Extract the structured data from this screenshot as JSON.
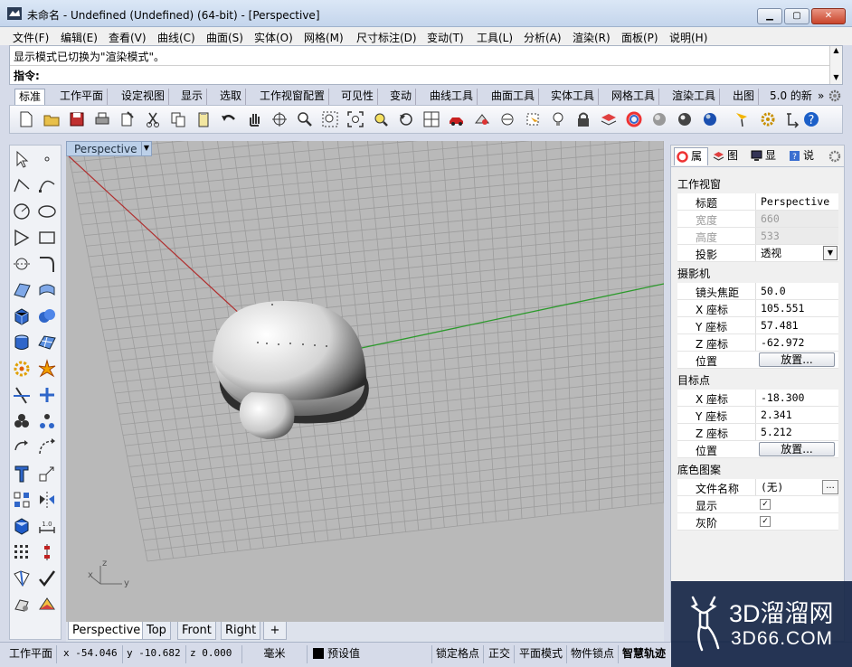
{
  "window": {
    "title": "未命名 - Undefined (Undefined) (64-bit) - [Perspective]",
    "minimize": "▁",
    "maximize": "▢",
    "close": "✕"
  },
  "menu": [
    "文件(F)",
    "编辑(E)",
    "查看(V)",
    "曲线(C)",
    "曲面(S)",
    "实体(O)",
    "网格(M)",
    "尺寸标注(D)",
    "变动(T)",
    "工具(L)",
    "分析(A)",
    "渲染(R)",
    "面板(P)",
    "说明(H)"
  ],
  "command": {
    "message": "显示模式已切换为\"渲染模式\"。",
    "prompt": "指令:"
  },
  "toolbar_tabs": [
    "标准",
    "工作平面",
    "设定视图",
    "显示",
    "选取",
    "工作视窗配置",
    "可见性",
    "变动",
    "曲线工具",
    "曲面工具",
    "实体工具",
    "网格工具",
    "渲染工具",
    "出图",
    "5.0 的新"
  ],
  "toolbar_tabs_more": "»",
  "viewport": {
    "title": "Perspective",
    "dropdown": "▼",
    "axis_labels": {
      "x": "x",
      "y": "y",
      "z": "z"
    }
  },
  "viewport_tabs": [
    "Perspective",
    "Top",
    "Front",
    "Right"
  ],
  "viewport_tab_add": "+",
  "panel": {
    "tabs": [
      "属",
      "图",
      "显",
      "说"
    ],
    "viewport_section": "工作视窗",
    "title_label": "标题",
    "title_value": "Perspective",
    "width_label": "宽度",
    "width_value": "660",
    "height_label": "高度",
    "height_value": "533",
    "projection_label": "投影",
    "projection_value": "透视",
    "projection_dd": "▼",
    "camera_section": "摄影机",
    "lens_label": "镜头焦距",
    "lens_value": "50.0",
    "cam_x_label": "X 座标",
    "cam_x_value": "105.551",
    "cam_y_label": "Y 座标",
    "cam_y_value": "57.481",
    "cam_z_label": "Z 座标",
    "cam_z_value": "-62.972",
    "cam_pos_label": "位置",
    "place_button": "放置...",
    "target_section": "目标点",
    "tgt_x_label": "X 座标",
    "tgt_x_value": "-18.300",
    "tgt_y_label": "Y 座标",
    "tgt_y_value": "2.341",
    "tgt_z_label": "Z 座标",
    "tgt_z_value": "5.212",
    "tgt_pos_label": "位置",
    "place_button2": "放置...",
    "wallpaper_section": "底色图案",
    "filename_label": "文件名称",
    "filename_value": "(无)",
    "browse": "...",
    "show_label": "显示",
    "gray_label": "灰阶",
    "check": "✓"
  },
  "status": {
    "cplane": "工作平面",
    "x": "x -54.046",
    "y": "y -10.682",
    "z": "z 0.000",
    "units": "毫米",
    "layer": "预设值",
    "snap": "锁定格点",
    "ortho": "正交",
    "planar": "平面模式",
    "osnap": "物件锁点",
    "smarttrack": "智慧轨迹"
  },
  "watermark": {
    "brand": "3D溜溜网",
    "url": "3D66.COM"
  },
  "colors": {
    "x_axis": "#b03030",
    "y_axis": "#2c9a2c",
    "grid": "#9a9a9a",
    "viewport_bg": "#b9b9b9"
  }
}
